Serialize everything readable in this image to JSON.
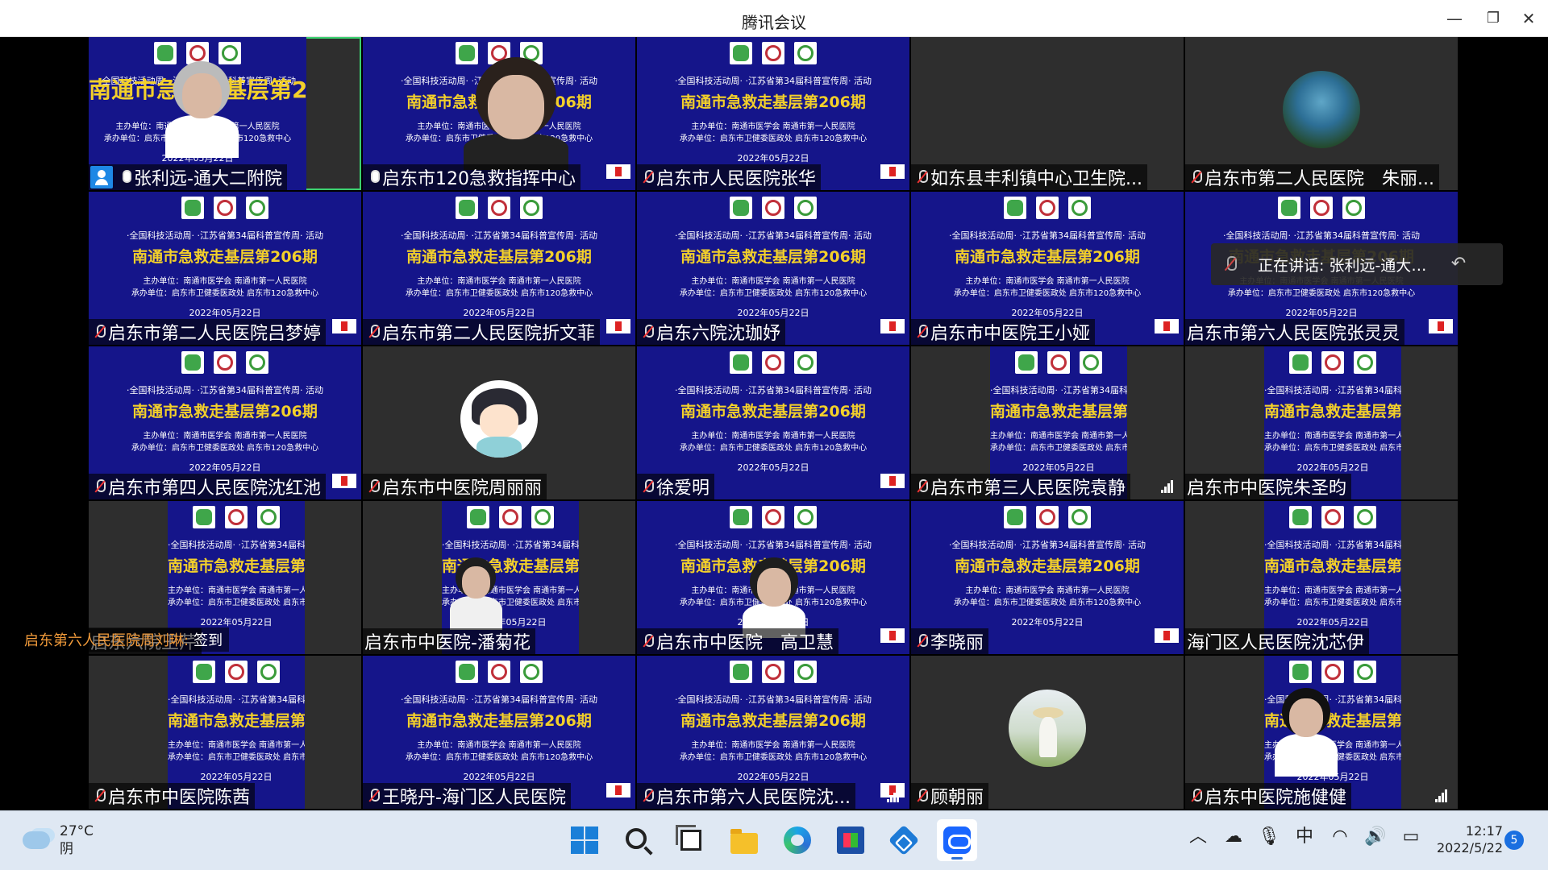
{
  "window": {
    "title": "腾讯会议",
    "minimize": "—",
    "maximize": "❐",
    "close": "✕"
  },
  "slide_text": {
    "line1": "·全国科技活动周· ·江苏省第34届科普宣传周· 活动",
    "title": "南通市急救走基层第206期",
    "host": "主办单位：南通市医学会 南通市第一人民医院",
    "organizer": "承办单位：启东市卫健委医政处 启东市120急救中心",
    "date": "2022年05月22日"
  },
  "participants": [
    {
      "name": "张利远-通大二附院",
      "mic": "on",
      "speaking": true,
      "host_badge": true
    },
    {
      "name": "启东市120急救指挥中心",
      "mic": "on"
    },
    {
      "name": "启东市人民医院张华",
      "mic": "off"
    },
    {
      "name": "如东县丰利镇中心卫生院...",
      "mic": "off"
    },
    {
      "name": "启东市第二人民医院　朱丽...",
      "mic": "off"
    },
    {
      "name": "启东市第二人民医院吕梦婷",
      "mic": "off"
    },
    {
      "name": "启东市第二人民医院折文菲",
      "mic": "off"
    },
    {
      "name": "启东六院沈珈妤",
      "mic": "off"
    },
    {
      "name": "启东市中医院王小娅",
      "mic": "off"
    },
    {
      "name": "启东市第六人民医院张灵灵",
      "mic": "none"
    },
    {
      "name": "启东市第四人民医院沈红池",
      "mic": "off"
    },
    {
      "name": "启东市中医院周丽丽",
      "mic": "off"
    },
    {
      "name": "徐爱明",
      "mic": "off"
    },
    {
      "name": "启东市第三人民医院袁静",
      "mic": "off"
    },
    {
      "name": "启东市中医院朱圣昀",
      "mic": "none"
    },
    {
      "name": "启东六院王芹",
      "mic": "none"
    },
    {
      "name": "启东市中医院-潘菊花",
      "mic": "none"
    },
    {
      "name": "启东市中医院　高卫慧",
      "mic": "off"
    },
    {
      "name": "李晓丽",
      "mic": "off"
    },
    {
      "name": "海门区人民医院沈芯伊",
      "mic": "none"
    },
    {
      "name": "启东市中医院陈茜",
      "mic": "off"
    },
    {
      "name": "王晓丹-海门区人民医院",
      "mic": "off"
    },
    {
      "name": "启东市第六人民医院沈...",
      "mic": "off"
    },
    {
      "name": "顾朝丽",
      "mic": "off"
    },
    {
      "name": "启东中医院施健健",
      "mic": "off"
    }
  ],
  "speaking_toast": {
    "text": "正在讲话: 张利远-通大二...",
    "icon": "mic-muted-icon"
  },
  "signin_note": {
    "name": "启东第六人民医院周刘琳:",
    "action": "签到"
  },
  "taskbar": {
    "weather_temp": "27°C",
    "weather_desc": "阴",
    "icons": [
      "start-icon",
      "search-icon",
      "task-view-icon",
      "file-explorer-icon",
      "edge-icon",
      "store-icon",
      "app-icon",
      "tencent-meeting-icon"
    ],
    "tray_ime": "中",
    "time": "12:17",
    "date": "2022/5/22",
    "notifications": "5"
  },
  "colors": {
    "slide_bg": "#15158a",
    "slide_title": "#f3d02a",
    "speaking_border": "#3bd16f",
    "signin_name": "#f09a3a"
  }
}
